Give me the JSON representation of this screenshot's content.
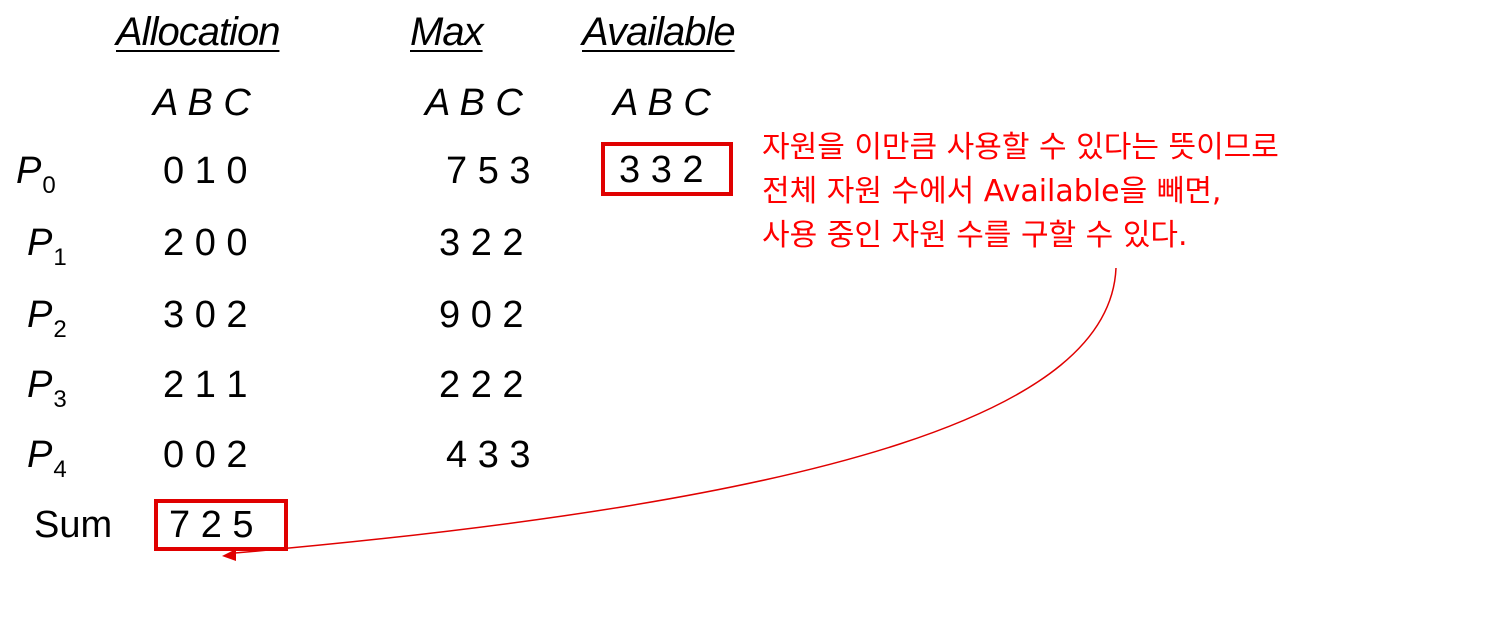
{
  "headers": {
    "allocation": "Allocation",
    "max": "Max",
    "available": "Available"
  },
  "subheaders": {
    "allocation": "A B C",
    "max": "A B C",
    "available": "A B C"
  },
  "processes": [
    {
      "name": "P",
      "sub": "0",
      "allocation": "0 1 0",
      "max": "7 5 3"
    },
    {
      "name": "P",
      "sub": "1",
      "allocation": "2 0 0",
      "max": "3 2 2"
    },
    {
      "name": "P",
      "sub": "2",
      "allocation": "3 0 2",
      "max": "9 0 2"
    },
    {
      "name": "P",
      "sub": "3",
      "allocation": "2 1 1",
      "max": "2 2 2"
    },
    {
      "name": "P",
      "sub": "4",
      "allocation": "0 0 2",
      "max": "4 3 3"
    }
  ],
  "available": "3 3 2",
  "sum": {
    "label": "Sum",
    "value": "7 2 5"
  },
  "note": {
    "lines": [
      "자원을 이만큼 사용할 수 있다는 뜻이므로",
      "전체 자원 수에서 Available을 빼면,",
      "사용 중인 자원 수를 구할 수 있다."
    ],
    "color": "#ff0000"
  },
  "highlight_color": "#e00000"
}
